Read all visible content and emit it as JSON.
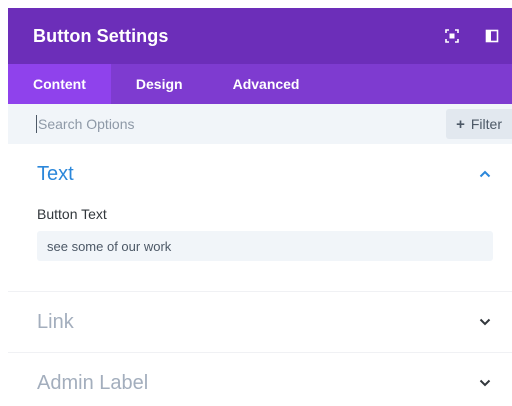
{
  "header": {
    "title": "Button Settings",
    "icons": [
      "fullscreen-icon",
      "sidebar-icon"
    ]
  },
  "tabs": [
    {
      "label": "Content",
      "active": true
    },
    {
      "label": "Design",
      "active": false
    },
    {
      "label": "Advanced",
      "active": false
    }
  ],
  "search": {
    "placeholder": "Search Options",
    "value": ""
  },
  "filter": {
    "label": "Filter",
    "icon": "plus-icon"
  },
  "groups": [
    {
      "title": "Text",
      "open": true,
      "fields": [
        {
          "label": "Button Text",
          "value": "see some of our work"
        }
      ]
    },
    {
      "title": "Link",
      "open": false
    },
    {
      "title": "Admin Label",
      "open": false
    }
  ],
  "colors": {
    "header_bg": "#6c2eb9",
    "tabs_bg": "#7e3bd0",
    "active_tab_bg": "#8f42ec",
    "open_group_title": "#2b87da",
    "closed_group_title": "#a3aebd"
  }
}
